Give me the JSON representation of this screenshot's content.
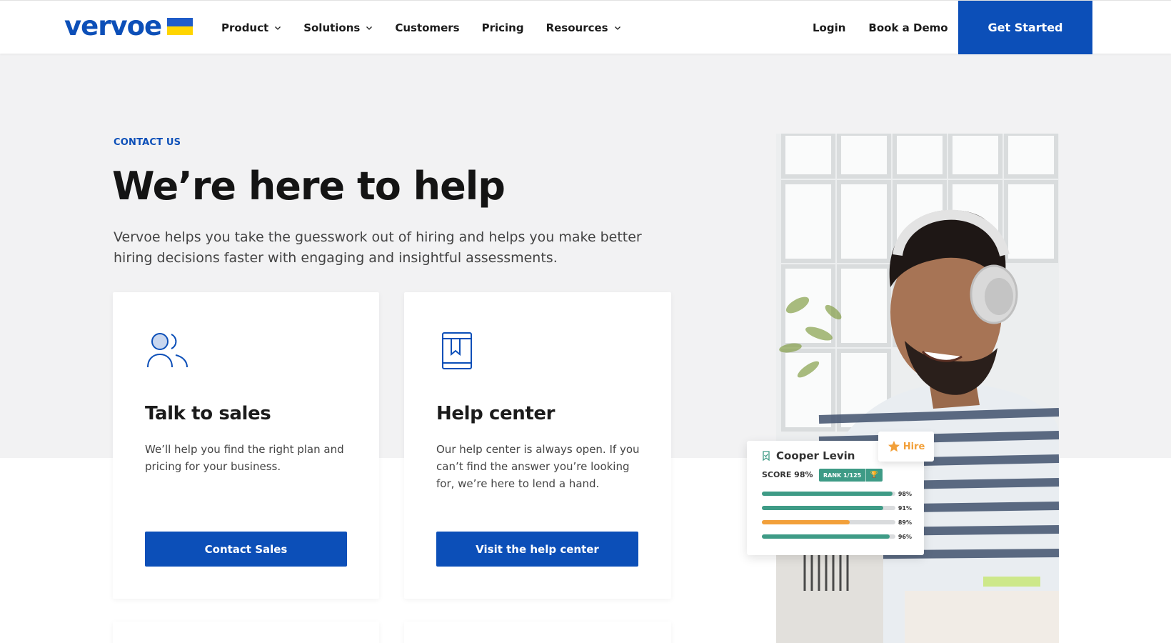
{
  "brand": {
    "name": "vervoe",
    "accent": "#0c4fb8",
    "flag_top": "#1f5cc8",
    "flag_bottom": "#ffd500"
  },
  "nav": {
    "items": [
      {
        "label": "Product",
        "dropdown": true
      },
      {
        "label": "Solutions",
        "dropdown": true
      },
      {
        "label": "Customers",
        "dropdown": false
      },
      {
        "label": "Pricing",
        "dropdown": false
      },
      {
        "label": "Resources",
        "dropdown": true
      }
    ],
    "login": "Login",
    "demo": "Book a Demo",
    "cta": "Get Started"
  },
  "hero": {
    "eyebrow": "CONTACT US",
    "title": "We’re here to help",
    "intro": "Vervoe helps you take the guesswork out of hiring and helps you make better hiring decisions faster with engaging and insightful assessments."
  },
  "cards": [
    {
      "icon": "users-icon",
      "title": "Talk to sales",
      "desc": "We’ll help you find the right plan and pricing for your business.",
      "button": "Contact Sales"
    },
    {
      "icon": "book-icon",
      "title": "Help center",
      "desc": "Our help center is always open. If you can’t find the answer you’re looking for, we’re here to lend a hand.",
      "button": "Visit the help center"
    }
  ],
  "candidate": {
    "name": "Cooper Levin",
    "score": "SCORE 98%",
    "rank": "RANK 1/125",
    "hire": "Hire",
    "bars": [
      {
        "value": 0.98,
        "label": "98%",
        "color": "#3e9b86"
      },
      {
        "value": 0.91,
        "label": "91%",
        "color": "#3e9b86"
      },
      {
        "value": 0.89,
        "label": "89%",
        "color": "#f2a03a",
        "fill": 0.66
      },
      {
        "value": 0.96,
        "label": "96%",
        "color": "#3e9b86"
      }
    ]
  }
}
